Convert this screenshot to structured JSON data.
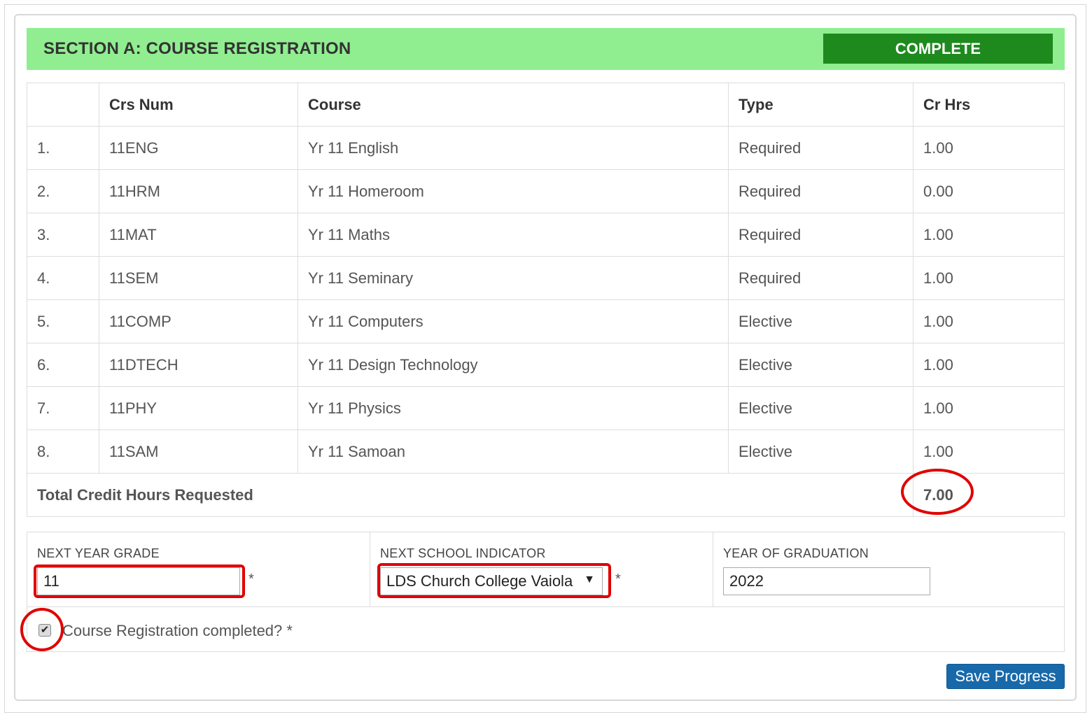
{
  "section": {
    "title": "SECTION A: COURSE REGISTRATION",
    "status": "COMPLETE",
    "header_color": "#90ee90",
    "status_color": "#1e8a1e"
  },
  "table": {
    "headers": [
      "",
      "Crs Num",
      "Course",
      "Type",
      "Cr Hrs"
    ],
    "rows": [
      {
        "num": "1.",
        "crs": "11ENG",
        "course": "Yr 11 English",
        "type": "Required",
        "hrs": "1.00"
      },
      {
        "num": "2.",
        "crs": "11HRM",
        "course": "Yr 11 Homeroom",
        "type": "Required",
        "hrs": "0.00"
      },
      {
        "num": "3.",
        "crs": "11MAT",
        "course": "Yr 11 Maths",
        "type": "Required",
        "hrs": "1.00"
      },
      {
        "num": "4.",
        "crs": "11SEM",
        "course": "Yr 11 Seminary",
        "type": "Required",
        "hrs": "1.00"
      },
      {
        "num": "5.",
        "crs": "11COMP",
        "course": "Yr 11 Computers",
        "type": "Elective",
        "hrs": "1.00"
      },
      {
        "num": "6.",
        "crs": "11DTECH",
        "course": "Yr 11 Design Technology",
        "type": "Elective",
        "hrs": "1.00"
      },
      {
        "num": "7.",
        "crs": "11PHY",
        "course": "Yr 11 Physics",
        "type": "Elective",
        "hrs": "1.00"
      },
      {
        "num": "8.",
        "crs": "11SAM",
        "course": "Yr 11 Samoan",
        "type": "Elective",
        "hrs": "1.00"
      }
    ],
    "total_label": "Total Credit Hours Requested",
    "total_value": "7.00"
  },
  "form": {
    "next_year_grade": {
      "label": "NEXT YEAR GRADE",
      "value": "11",
      "required": "*"
    },
    "next_school": {
      "label": "NEXT SCHOOL INDICATOR",
      "value": "LDS Church College Vaiola",
      "required": "*"
    },
    "graduation_year": {
      "label": "YEAR OF GRADUATION",
      "value": "2022"
    },
    "completed_checkbox": {
      "label": "Course Registration completed? *",
      "checked": true
    }
  },
  "save_button": {
    "label": "Save Progress",
    "color": "#1769aa"
  },
  "highlight_color": "#e00000"
}
